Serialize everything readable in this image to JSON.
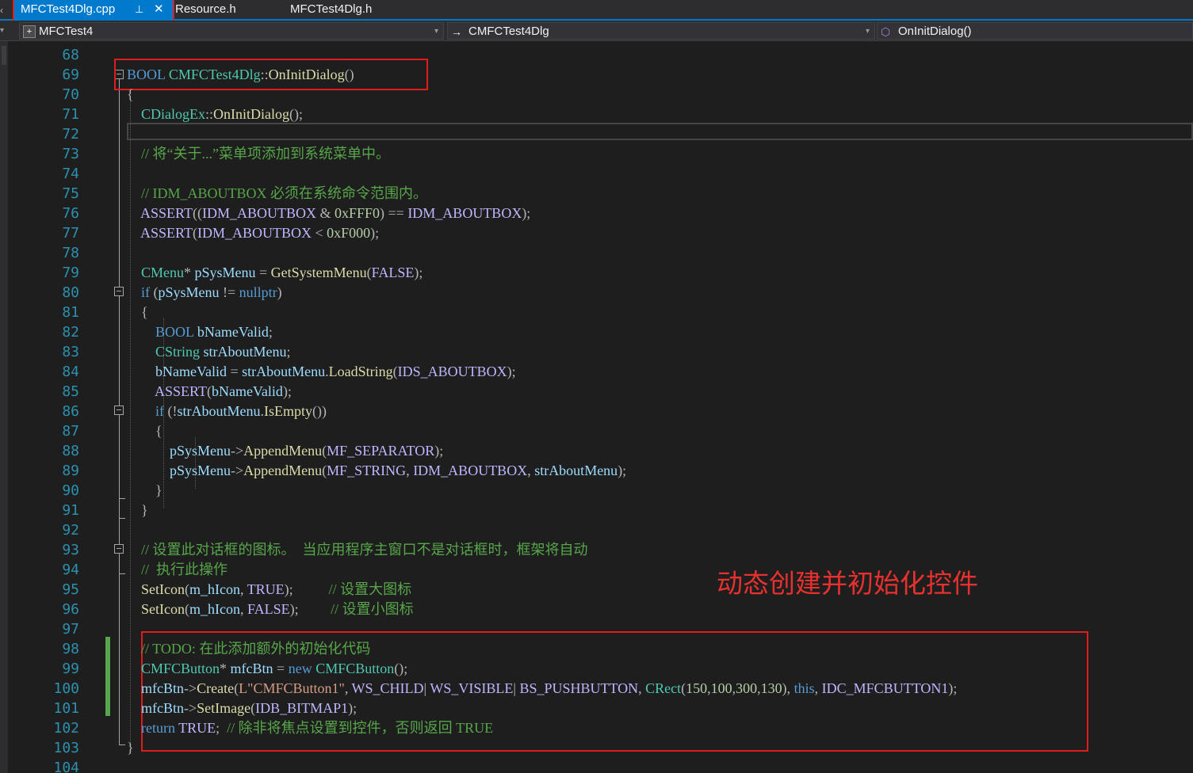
{
  "tabs": {
    "active": {
      "label": "MFCTest4Dlg.cpp",
      "pin_icon": "pin-icon",
      "close_icon": "close-icon"
    },
    "others": [
      "Resource.h",
      "MFCTest4Dlg.h"
    ]
  },
  "navbar": {
    "project": "MFCTest4",
    "class": "CMFCTest4Dlg",
    "member": "OnInitDialog()"
  },
  "annotation": "动态创建并初始化控件",
  "line_numbers": [
    "68",
    "69",
    "70",
    "71",
    "72",
    "73",
    "74",
    "75",
    "76",
    "77",
    "78",
    "79",
    "80",
    "81",
    "82",
    "83",
    "84",
    "85",
    "86",
    "87",
    "88",
    "89",
    "90",
    "91",
    "92",
    "93",
    "94",
    "95",
    "96",
    "97",
    "98",
    "99",
    "100",
    "101",
    "102",
    "103",
    "104"
  ],
  "code_lines": [
    [],
    [
      [
        "t-kw",
        "BOOL "
      ],
      [
        "t-ty",
        "CMFCTest4Dlg"
      ],
      [
        "t-op",
        "::"
      ],
      [
        "t-fn",
        "OnInitDialog"
      ],
      [
        "t-op",
        "()"
      ]
    ],
    [
      [
        "t-op",
        "{"
      ]
    ],
    [
      [
        "t-pl",
        "    "
      ],
      [
        "t-ty",
        "CDialogEx"
      ],
      [
        "t-op",
        "::"
      ],
      [
        "t-fn",
        "OnInitDialog"
      ],
      [
        "t-op",
        "();"
      ]
    ],
    [],
    [
      [
        "t-pl",
        "    "
      ],
      [
        "t-cm",
        "// 将“关于...”菜单项添加到系统菜单中。"
      ]
    ],
    [],
    [
      [
        "t-pl",
        "    "
      ],
      [
        "t-cm",
        "// IDM_ABOUTBOX 必须在系统命令范围内。"
      ]
    ],
    [
      [
        "t-pl",
        "    "
      ],
      [
        "t-mac",
        "ASSERT"
      ],
      [
        "t-op",
        "(("
      ],
      [
        "t-mac",
        "IDM_ABOUTBOX"
      ],
      [
        "t-op",
        " & "
      ],
      [
        "t-num",
        "0xFFF0"
      ],
      [
        "t-op",
        ") == "
      ],
      [
        "t-mac",
        "IDM_ABOUTBOX"
      ],
      [
        "t-op",
        ");"
      ]
    ],
    [
      [
        "t-pl",
        "    "
      ],
      [
        "t-mac",
        "ASSERT"
      ],
      [
        "t-op",
        "("
      ],
      [
        "t-mac",
        "IDM_ABOUTBOX"
      ],
      [
        "t-op",
        " < "
      ],
      [
        "t-num",
        "0xF000"
      ],
      [
        "t-op",
        ");"
      ]
    ],
    [],
    [
      [
        "t-pl",
        "    "
      ],
      [
        "t-ty",
        "CMenu"
      ],
      [
        "t-op",
        "* "
      ],
      [
        "t-var",
        "pSysMenu"
      ],
      [
        "t-op",
        " = "
      ],
      [
        "t-fn",
        "GetSystemMenu"
      ],
      [
        "t-op",
        "("
      ],
      [
        "t-mac",
        "FALSE"
      ],
      [
        "t-op",
        ");"
      ]
    ],
    [
      [
        "t-pl",
        "    "
      ],
      [
        "t-kw",
        "if"
      ],
      [
        "t-op",
        " ("
      ],
      [
        "t-var",
        "pSysMenu"
      ],
      [
        "t-op",
        " != "
      ],
      [
        "t-kw",
        "nullptr"
      ],
      [
        "t-op",
        ")"
      ]
    ],
    [
      [
        "t-pl",
        "    "
      ],
      [
        "t-op",
        "{"
      ]
    ],
    [
      [
        "t-pl",
        "        "
      ],
      [
        "t-kw",
        "BOOL "
      ],
      [
        "t-var",
        "bNameValid"
      ],
      [
        "t-op",
        ";"
      ]
    ],
    [
      [
        "t-pl",
        "        "
      ],
      [
        "t-ty",
        "CString "
      ],
      [
        "t-var",
        "strAboutMenu"
      ],
      [
        "t-op",
        ";"
      ]
    ],
    [
      [
        "t-pl",
        "        "
      ],
      [
        "t-var",
        "bNameValid"
      ],
      [
        "t-op",
        " = "
      ],
      [
        "t-var",
        "strAboutMenu"
      ],
      [
        "t-op",
        "."
      ],
      [
        "t-fn",
        "LoadString"
      ],
      [
        "t-op",
        "("
      ],
      [
        "t-mac",
        "IDS_ABOUTBOX"
      ],
      [
        "t-op",
        ");"
      ]
    ],
    [
      [
        "t-pl",
        "        "
      ],
      [
        "t-mac",
        "ASSERT"
      ],
      [
        "t-op",
        "("
      ],
      [
        "t-var",
        "bNameValid"
      ],
      [
        "t-op",
        ");"
      ]
    ],
    [
      [
        "t-pl",
        "        "
      ],
      [
        "t-kw",
        "if"
      ],
      [
        "t-op",
        " (!"
      ],
      [
        "t-var",
        "strAboutMenu"
      ],
      [
        "t-op",
        "."
      ],
      [
        "t-fn",
        "IsEmpty"
      ],
      [
        "t-op",
        "())"
      ]
    ],
    [
      [
        "t-pl",
        "        "
      ],
      [
        "t-op",
        "{"
      ]
    ],
    [
      [
        "t-pl",
        "            "
      ],
      [
        "t-var",
        "pSysMenu"
      ],
      [
        "t-op",
        "->"
      ],
      [
        "t-fn",
        "AppendMenu"
      ],
      [
        "t-op",
        "("
      ],
      [
        "t-mac",
        "MF_SEPARATOR"
      ],
      [
        "t-op",
        ");"
      ]
    ],
    [
      [
        "t-pl",
        "            "
      ],
      [
        "t-var",
        "pSysMenu"
      ],
      [
        "t-op",
        "->"
      ],
      [
        "t-fn",
        "AppendMenu"
      ],
      [
        "t-op",
        "("
      ],
      [
        "t-mac",
        "MF_STRING"
      ],
      [
        "t-op",
        ", "
      ],
      [
        "t-mac",
        "IDM_ABOUTBOX"
      ],
      [
        "t-op",
        ", "
      ],
      [
        "t-var",
        "strAboutMenu"
      ],
      [
        "t-op",
        ");"
      ]
    ],
    [
      [
        "t-pl",
        "        "
      ],
      [
        "t-op",
        "}"
      ]
    ],
    [
      [
        "t-pl",
        "    "
      ],
      [
        "t-op",
        "}"
      ]
    ],
    [],
    [
      [
        "t-pl",
        "    "
      ],
      [
        "t-cm",
        "// 设置此对话框的图标。  当应用程序主窗口不是对话框时，框架将自动"
      ]
    ],
    [
      [
        "t-pl",
        "    "
      ],
      [
        "t-cm",
        "//  执行此操作"
      ]
    ],
    [
      [
        "t-pl",
        "    "
      ],
      [
        "t-fn",
        "SetIcon"
      ],
      [
        "t-op",
        "("
      ],
      [
        "t-var",
        "m_hIcon"
      ],
      [
        "t-op",
        ", "
      ],
      [
        "t-mac",
        "TRUE"
      ],
      [
        "t-op",
        ");          "
      ],
      [
        "t-cm",
        "// 设置大图标"
      ]
    ],
    [
      [
        "t-pl",
        "    "
      ],
      [
        "t-fn",
        "SetIcon"
      ],
      [
        "t-op",
        "("
      ],
      [
        "t-var",
        "m_hIcon"
      ],
      [
        "t-op",
        ", "
      ],
      [
        "t-mac",
        "FALSE"
      ],
      [
        "t-op",
        ");         "
      ],
      [
        "t-cm",
        "// 设置小图标"
      ]
    ],
    [],
    [
      [
        "t-pl",
        "    "
      ],
      [
        "t-cm",
        "// TODO: 在此添加额外的初始化代码"
      ]
    ],
    [
      [
        "t-pl",
        "    "
      ],
      [
        "t-ty",
        "CMFCButton"
      ],
      [
        "t-op",
        "* "
      ],
      [
        "t-var",
        "mfcBtn"
      ],
      [
        "t-op",
        " = "
      ],
      [
        "t-kw",
        "new "
      ],
      [
        "t-ty",
        "CMFCButton"
      ],
      [
        "t-op",
        "();"
      ]
    ],
    [
      [
        "t-pl",
        "    "
      ],
      [
        "t-var",
        "mfcBtn"
      ],
      [
        "t-op",
        "->"
      ],
      [
        "t-fn",
        "Create"
      ],
      [
        "t-op",
        "("
      ],
      [
        "t-str",
        "L\"CMFCButton1\""
      ],
      [
        "t-op",
        ", "
      ],
      [
        "t-mac",
        "WS_CHILD"
      ],
      [
        "t-op",
        "| "
      ],
      [
        "t-mac",
        "WS_VISIBLE"
      ],
      [
        "t-op",
        "| "
      ],
      [
        "t-mac",
        "BS_PUSHBUTTON"
      ],
      [
        "t-op",
        ", "
      ],
      [
        "t-ty",
        "CRect"
      ],
      [
        "t-op",
        "("
      ],
      [
        "t-num",
        "150"
      ],
      [
        "t-op",
        ","
      ],
      [
        "t-num",
        "100"
      ],
      [
        "t-op",
        ","
      ],
      [
        "t-num",
        "300"
      ],
      [
        "t-op",
        ","
      ],
      [
        "t-num",
        "130"
      ],
      [
        "t-op",
        "), "
      ],
      [
        "t-kw",
        "this"
      ],
      [
        "t-op",
        ", "
      ],
      [
        "t-mac",
        "IDC_MFCBUTTON1"
      ],
      [
        "t-op",
        ");"
      ]
    ],
    [
      [
        "t-pl",
        "    "
      ],
      [
        "t-var",
        "mfcBtn"
      ],
      [
        "t-op",
        "->"
      ],
      [
        "t-fn",
        "SetImage"
      ],
      [
        "t-op",
        "("
      ],
      [
        "t-mac",
        "IDB_BITMAP1"
      ],
      [
        "t-op",
        ");"
      ]
    ],
    [
      [
        "t-pl",
        "    "
      ],
      [
        "t-kw",
        "return "
      ],
      [
        "t-mac",
        "TRUE"
      ],
      [
        "t-op",
        ";  "
      ],
      [
        "t-cm",
        "// 除非将焦点设置到控件，否则返回 TRUE"
      ]
    ],
    [
      [
        "t-op",
        "}"
      ]
    ],
    []
  ]
}
